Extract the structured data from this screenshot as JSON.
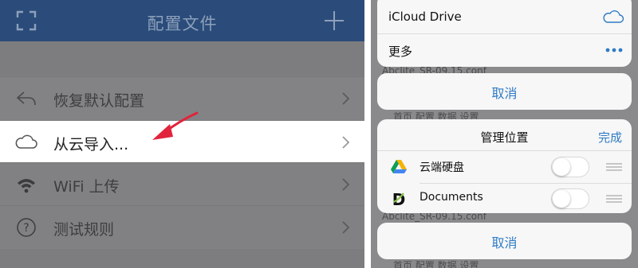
{
  "left": {
    "nav_title": "配置文件",
    "rows": [
      {
        "label": "恢复默认配置",
        "icon": "undo-arrow-icon"
      },
      {
        "label": "从云导入...",
        "icon": "cloud-icon"
      },
      {
        "label": "WiFi 上传",
        "icon": "wifi-icon"
      },
      {
        "label": "测试规则",
        "icon": "question-circle-icon"
      }
    ]
  },
  "right": {
    "behind_top": "Abclite_SR-09.15.conf",
    "behind_top_tabs": "首页        配置        数据        设置",
    "behind_bottom": "Abclite_SR-09.15.conf",
    "behind_bottom_tabs": "首页        配置        数据        设置",
    "menu": {
      "icloud": "iCloud Drive",
      "more": "更多"
    },
    "cancel_label": "取消",
    "manage": {
      "title": "管理位置",
      "done": "完成",
      "items": [
        {
          "label": "云端硬盘",
          "icon": "google-drive-icon",
          "enabled": false
        },
        {
          "label": "Documents",
          "icon": "documents-app-icon",
          "enabled": false
        }
      ]
    }
  },
  "colors": {
    "nav_bar": "#2b4c7a",
    "accent_blue": "#2f7bc4",
    "arrow_red": "#e2233c"
  }
}
